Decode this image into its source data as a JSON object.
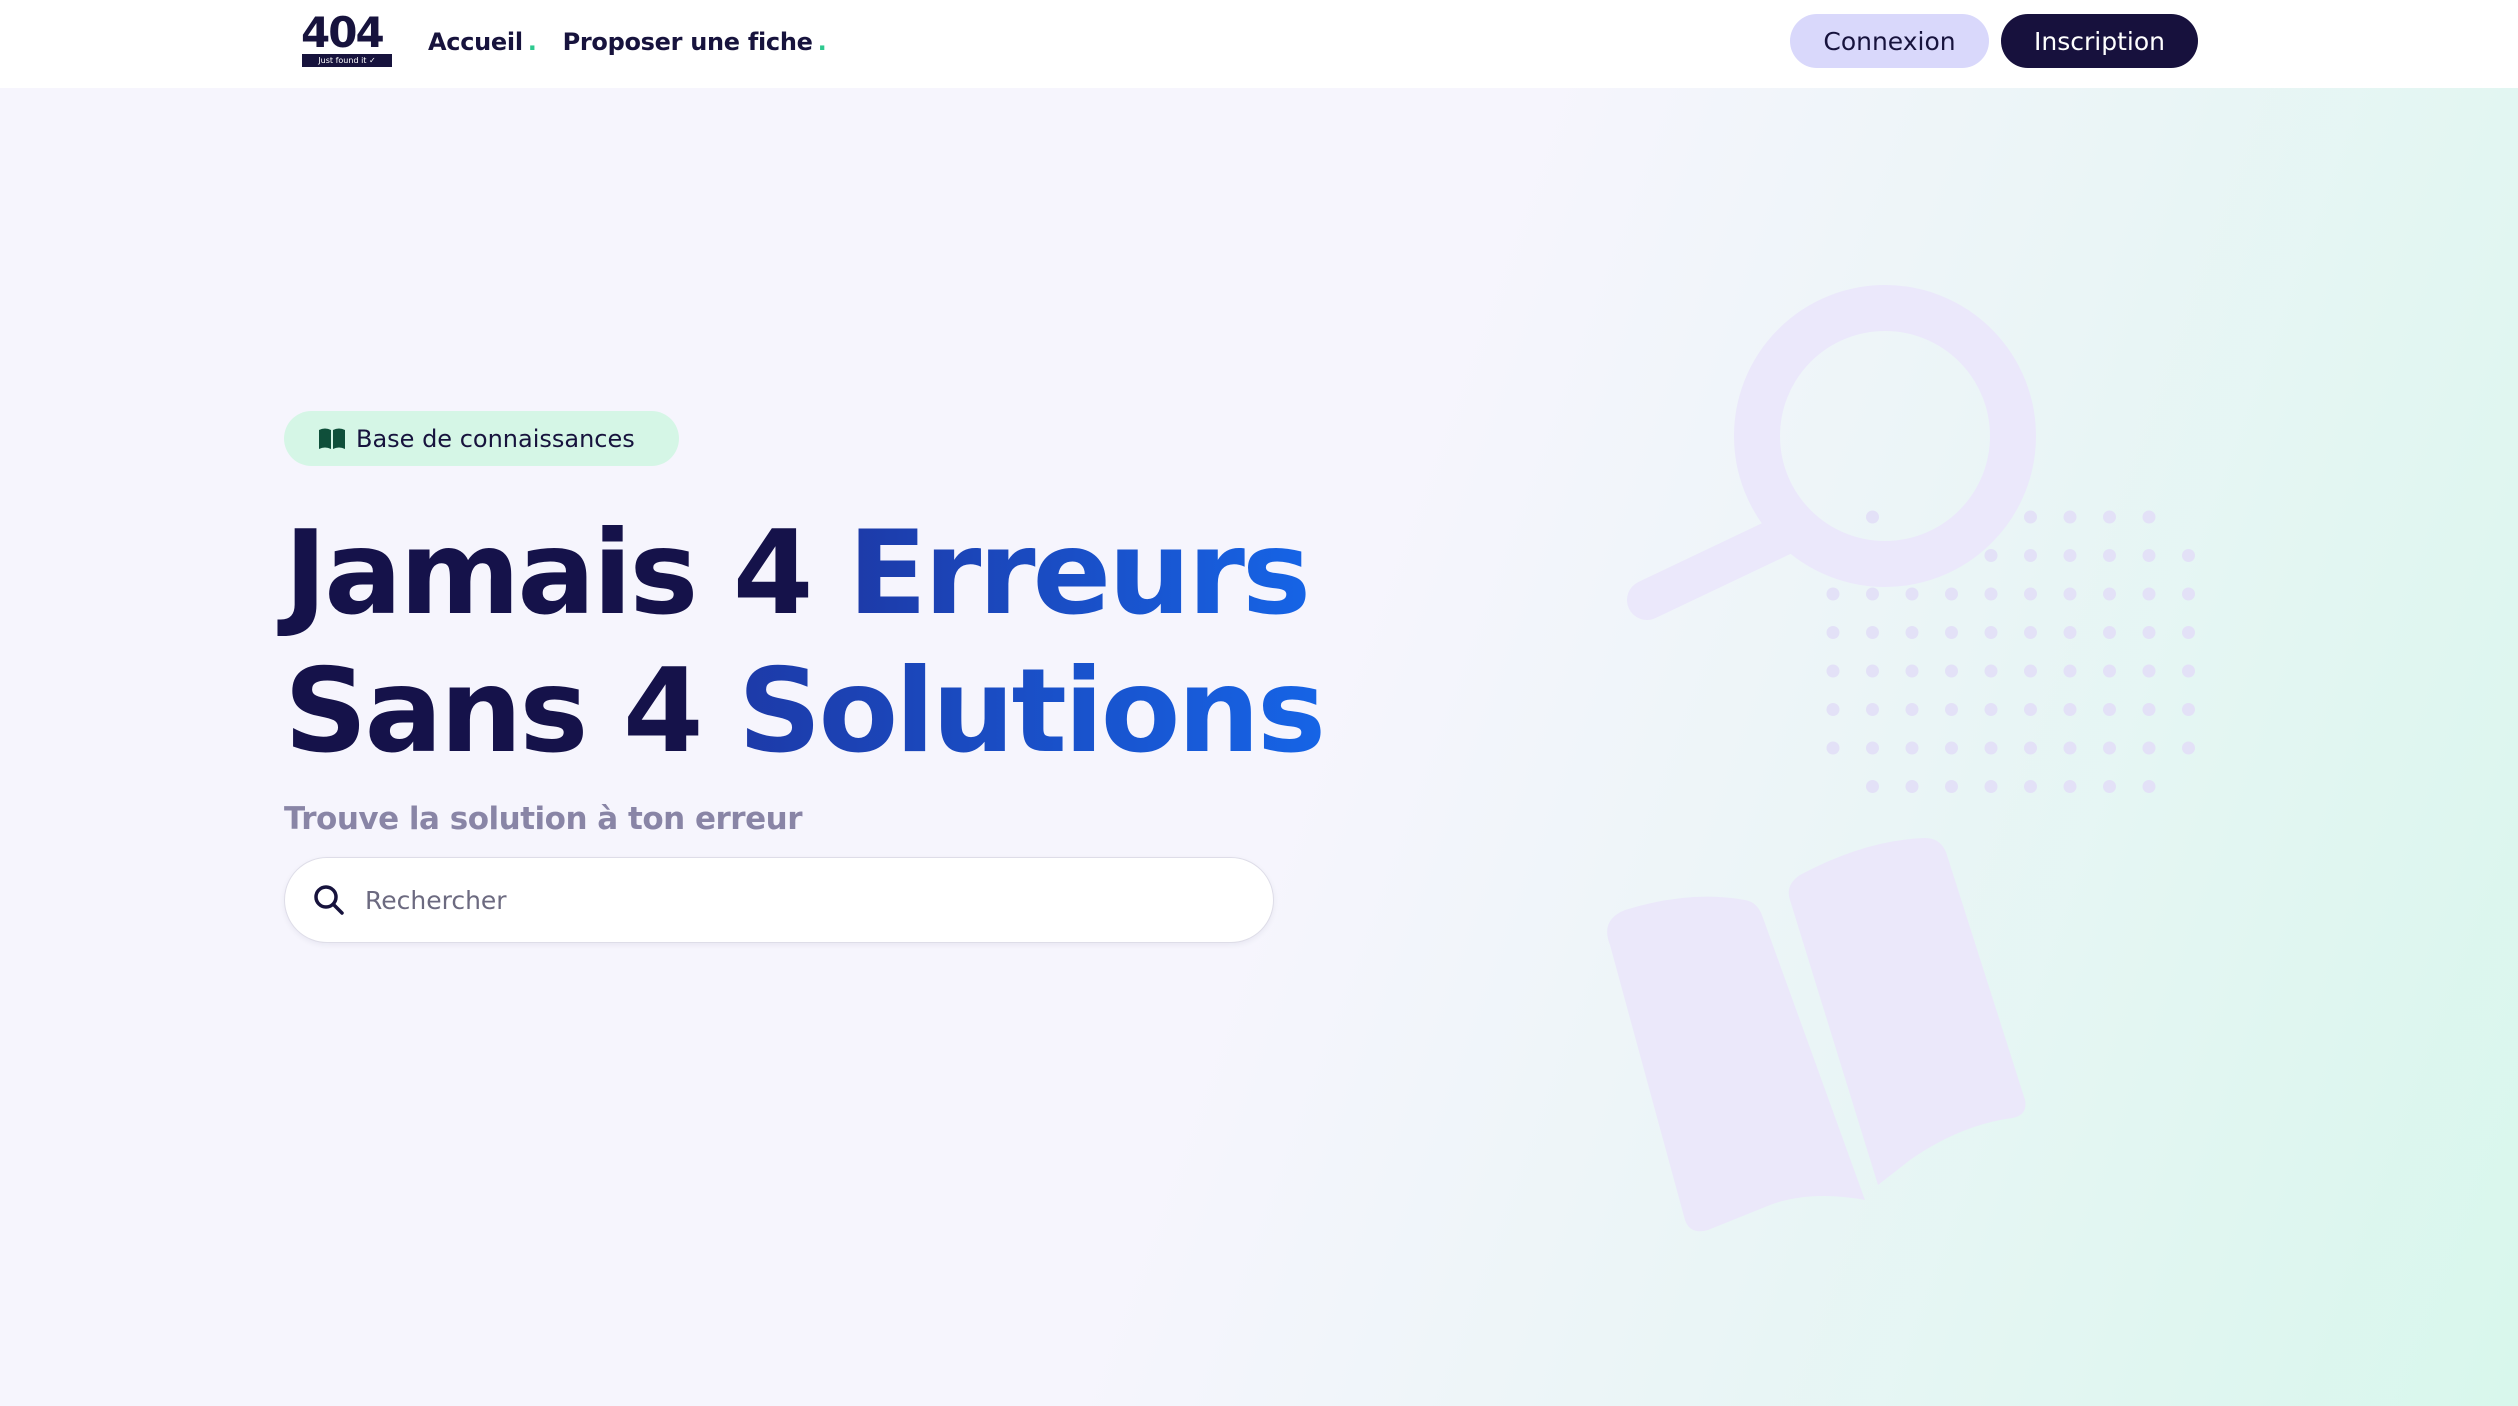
{
  "navbar": {
    "logo_number": "404",
    "logo_tagline": "Just found it ✓",
    "links": [
      {
        "label": "Accueil",
        "dot": "."
      },
      {
        "label": "Proposer une fiche",
        "dot": "."
      }
    ],
    "login_label": "Connexion",
    "signup_label": "Inscription"
  },
  "hero": {
    "badge_label": "Base de connaissances",
    "badge_icon": "open-book-icon",
    "headline": {
      "line1_start": "Jamais 4 ",
      "line1_highlight": "Erreurs",
      "line2_start": "Sans 4 ",
      "line2_highlight": "Solutions"
    },
    "subtitle": "Trouve la solution à ton erreur",
    "search": {
      "placeholder": "Rechercher",
      "value": "",
      "icon": "search-icon"
    }
  },
  "colors": {
    "brand_dark": "#17133d",
    "accent_green": "#2ec98f",
    "accent_blue": "#1664e6",
    "login_bg": "#d9d8fb",
    "badge_bg": "#d5f6e6"
  },
  "illustration": {
    "icons": [
      "magnifier-illustration",
      "dot-grid",
      "book-illustration"
    ]
  }
}
